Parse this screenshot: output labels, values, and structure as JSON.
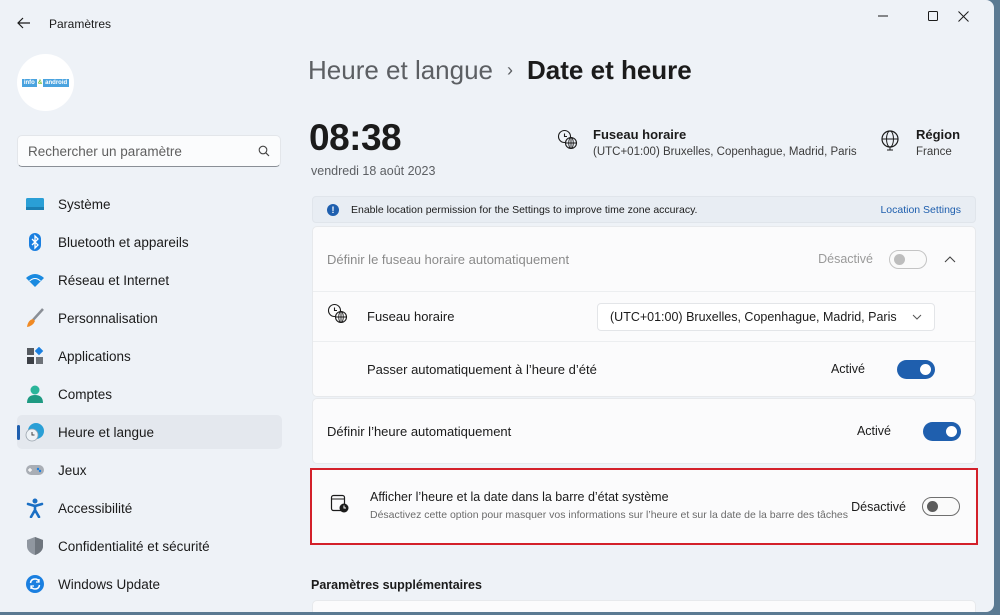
{
  "window": {
    "app_title": "Paramètres",
    "controls": {
      "minimize": "minimize-icon",
      "maximize": "maximize-icon",
      "close": "close-icon"
    }
  },
  "sidebar": {
    "avatar_logo": {
      "part1": "info",
      "part2": "&",
      "part3": "android"
    },
    "search": {
      "placeholder": "Rechercher un paramètre",
      "value": ""
    },
    "items": [
      {
        "label": "Système",
        "icon": "monitor-icon",
        "active": false
      },
      {
        "label": "Bluetooth et appareils",
        "icon": "bluetooth-icon",
        "active": false
      },
      {
        "label": "Réseau et Internet",
        "icon": "wifi-icon",
        "active": false
      },
      {
        "label": "Personnalisation",
        "icon": "brush-icon",
        "active": false
      },
      {
        "label": "Applications",
        "icon": "apps-icon",
        "active": false
      },
      {
        "label": "Comptes",
        "icon": "account-icon",
        "active": false
      },
      {
        "label": "Heure et langue",
        "icon": "time-language-icon",
        "active": true
      },
      {
        "label": "Jeux",
        "icon": "gamepad-icon",
        "active": false
      },
      {
        "label": "Accessibilité",
        "icon": "accessibility-icon",
        "active": false
      },
      {
        "label": "Confidentialité et sécurité",
        "icon": "shield-icon",
        "active": false
      },
      {
        "label": "Windows Update",
        "icon": "update-icon",
        "active": false
      }
    ]
  },
  "main": {
    "breadcrumb": {
      "parent": "Heure et langue",
      "separator": "›",
      "current": "Date et heure"
    },
    "clock": {
      "time": "08:38",
      "date": "vendredi 18 août 2023"
    },
    "timezone_summary": {
      "title": "Fuseau horaire",
      "value": "(UTC+01:00) Bruxelles, Copenhague, Madrid, Paris"
    },
    "region_summary": {
      "title": "Région",
      "value": "France"
    },
    "banner": {
      "text": "Enable location permission for the Settings to improve time zone accuracy.",
      "link": "Location Settings"
    },
    "auto_timezone": {
      "label": "Définir le fuseau horaire automatiquement",
      "state": "Désactivé",
      "enabled": false
    },
    "timezone_row": {
      "label": "Fuseau horaire",
      "selected": "(UTC+01:00) Bruxelles, Copenhague, Madrid, Paris"
    },
    "dst_row": {
      "label": "Passer automatiquement à l’heure d’été",
      "state": "Activé",
      "on": true
    },
    "auto_time": {
      "label": "Définir l’heure automatiquement",
      "state": "Activé",
      "on": true
    },
    "systray_row": {
      "title": "Afficher l’heure et la date dans la barre d’état système",
      "description": "Désactivez cette option pour masquer vos informations sur l’heure et sur la date de la barre des tâches",
      "state": "Désactivé",
      "on": false,
      "highlight_color": "#d3202a"
    },
    "more_section": {
      "title": "Paramètres supplémentaires"
    }
  },
  "colors": {
    "accent": "#1f5fae",
    "background": "#eef2f7",
    "highlight": "#d3202a"
  }
}
